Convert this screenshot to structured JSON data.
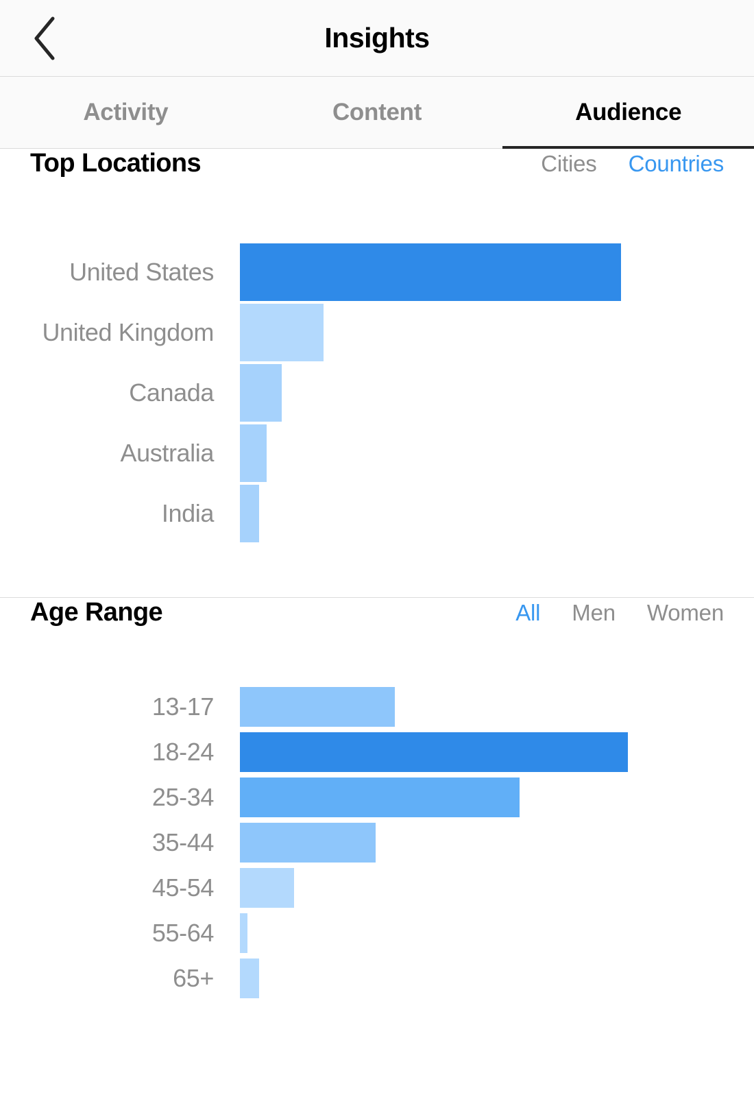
{
  "navbar": {
    "back_icon": "chevron-left-icon",
    "title": "Insights"
  },
  "tabs": [
    {
      "label": "Activity",
      "active": false
    },
    {
      "label": "Content",
      "active": false
    },
    {
      "label": "Audience",
      "active": true
    }
  ],
  "colors": {
    "accent": "#3897f0",
    "bar_primary": "#2f8ae8",
    "bar_strong": "#3897f0",
    "bar_mid": "#61aff7",
    "bar_light": "#8ec6fb",
    "bar_lighter": "#b3d9fd",
    "text_muted": "#8e8e8e",
    "text_dark": "#000000",
    "divider": "#dbdbdb",
    "nav_bg": "#fafafa"
  },
  "locations": {
    "title": "Top Locations",
    "segments": [
      {
        "label": "Cities",
        "active": false
      },
      {
        "label": "Countries",
        "active": true
      }
    ]
  },
  "age": {
    "title": "Age Range",
    "segments": [
      {
        "label": "All",
        "active": true
      },
      {
        "label": "Men",
        "active": false
      },
      {
        "label": "Women",
        "active": false
      }
    ]
  },
  "chart_data": [
    {
      "type": "bar",
      "id": "top-locations",
      "orientation": "horizontal",
      "title": "Top Locations",
      "xlabel": "",
      "ylabel": "",
      "grid": false,
      "legend": "none",
      "selected_segment": "Countries",
      "categories": [
        "United States",
        "United Kingdom",
        "Canada",
        "Australia",
        "India"
      ],
      "values": [
        100,
        22,
        11,
        7,
        5
      ],
      "value_unit": "percent-of-max",
      "bar_colors": [
        "#2f8ae8",
        "#b3d9fd",
        "#a6d2fc",
        "#a6d2fc",
        "#a6d2fc"
      ],
      "xlim": [
        0,
        100
      ]
    },
    {
      "type": "bar",
      "id": "age-range",
      "orientation": "horizontal",
      "title": "Age Range",
      "xlabel": "",
      "ylabel": "",
      "grid": false,
      "legend": "none",
      "selected_segment": "All",
      "categories": [
        "13-17",
        "18-24",
        "25-34",
        "35-44",
        "45-54",
        "55-64",
        "65+"
      ],
      "values": [
        40,
        100,
        72,
        35,
        14,
        2,
        5
      ],
      "value_unit": "percent-of-max",
      "bar_colors": [
        "#8ec6fb",
        "#2f8ae8",
        "#61aff7",
        "#8ec6fb",
        "#b3d9fd",
        "#b3d9fd",
        "#b3d9fd"
      ],
      "xlim": [
        0,
        100
      ]
    }
  ]
}
